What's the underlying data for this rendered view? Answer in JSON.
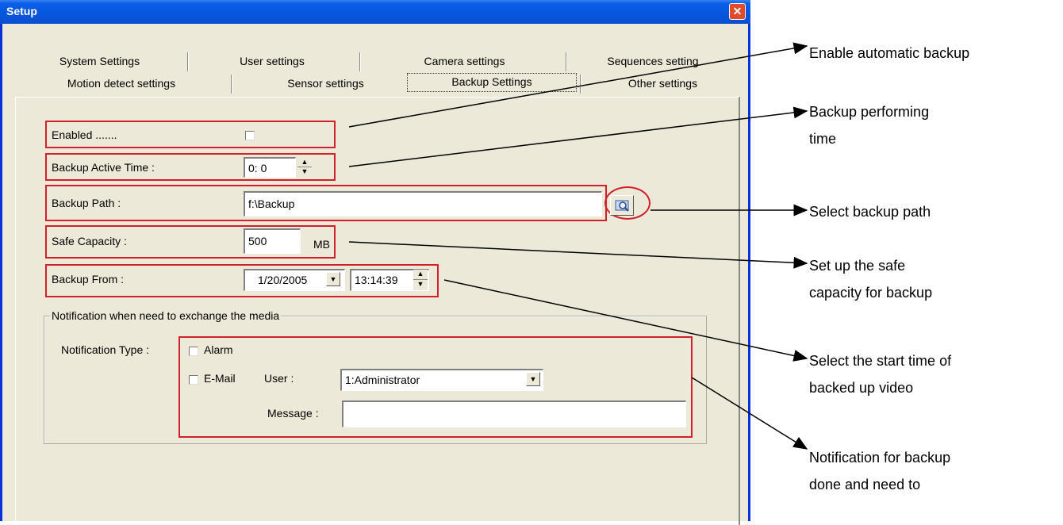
{
  "window": {
    "title": "Setup",
    "close_glyph": "✕"
  },
  "tabs": {
    "row1": [
      "System Settings",
      "User settings",
      "Camera settings",
      "Sequences setting"
    ],
    "row2": [
      "Motion detect settings",
      "Sensor settings",
      "Backup Settings",
      "Other settings"
    ],
    "active": "Backup Settings"
  },
  "form": {
    "enabled_label": "Enabled .......",
    "enabled_checked": false,
    "active_time_label": "Backup Active Time  :",
    "active_time_value": "0:  0",
    "path_label": "Backup Path :",
    "path_value": "f:\\Backup",
    "capacity_label": "Safe Capacity :",
    "capacity_value": "500",
    "capacity_unit": "MB",
    "from_label": "Backup From :",
    "from_date": "1/20/2005",
    "from_time": "13:14:39"
  },
  "notification": {
    "group_title": "Notification when need to exchange the media",
    "type_label": "Notification Type :",
    "alarm_label": "Alarm",
    "email_label": "E-Mail",
    "user_label": "User :",
    "user_value": "1:Administrator",
    "message_label": "Message :",
    "message_value": ""
  },
  "annotations": [
    {
      "lines": [
        "Enable automatic backup"
      ]
    },
    {
      "lines": [
        "Backup performing",
        "time"
      ]
    },
    {
      "lines": [
        "Select backup path"
      ]
    },
    {
      "lines": [
        "Set up the safe",
        "capacity for backup"
      ]
    },
    {
      "lines": [
        "Select the start time of",
        "backed up video"
      ]
    },
    {
      "lines": [
        "Notification for backup",
        "done and need to"
      ]
    }
  ],
  "colors": {
    "highlight": "#d0202a",
    "titlebar": "#0855dd"
  }
}
